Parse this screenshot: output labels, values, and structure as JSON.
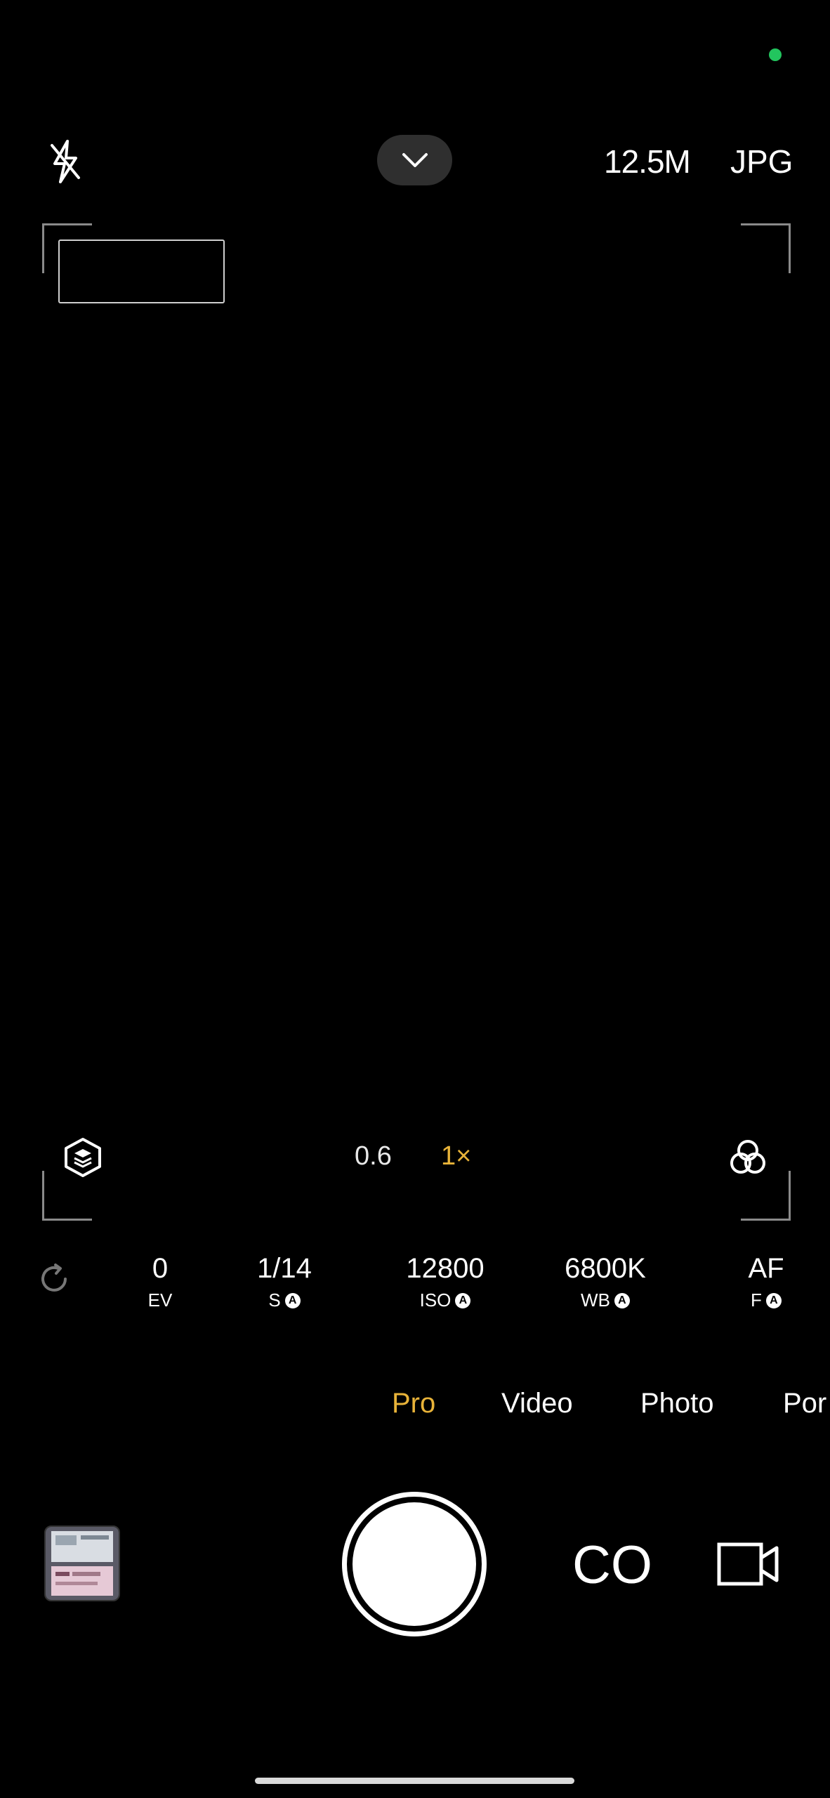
{
  "top_bar": {
    "resolution": "12.5M",
    "format": "JPG"
  },
  "zoom": {
    "options": [
      "0.6",
      "1×"
    ],
    "selected": "1×"
  },
  "pro_params": [
    {
      "value": "0",
      "label": "EV",
      "auto": false
    },
    {
      "value": "1/14",
      "label": "S",
      "auto": true
    },
    {
      "value": "12800",
      "label": "ISO",
      "auto": true
    },
    {
      "value": "6800K",
      "label": "WB",
      "auto": true
    },
    {
      "value": "AF",
      "label": "F",
      "auto": true
    }
  ],
  "auto_badge": "A",
  "modes": [
    {
      "label": "Pro",
      "selected": true
    },
    {
      "label": "Video",
      "selected": false
    },
    {
      "label": "Photo",
      "selected": false
    },
    {
      "label": "Por",
      "selected": false
    }
  ],
  "bottom": {
    "co_label": "CO"
  },
  "colors": {
    "accent": "#e8b339",
    "status_dot": "#22c55e"
  }
}
